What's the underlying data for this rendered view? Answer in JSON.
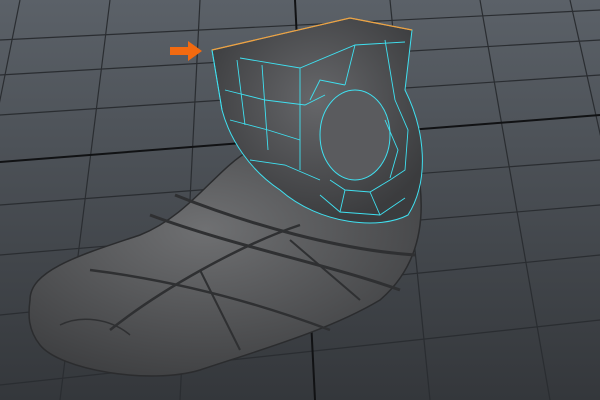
{
  "viewport": {
    "colors": {
      "background_top": "#5a6068",
      "background_bottom": "#33363a",
      "grid": "#2a2d31",
      "grid_axis": "#111214",
      "mesh": "#5c5d5f",
      "mesh_shadow": "#3a3b3d",
      "wireframe": "#3fe0f0",
      "selected_edge": "#f0a040",
      "arrow": "#f26a10"
    }
  },
  "annotation": {
    "icon": "arrow-right-icon"
  }
}
